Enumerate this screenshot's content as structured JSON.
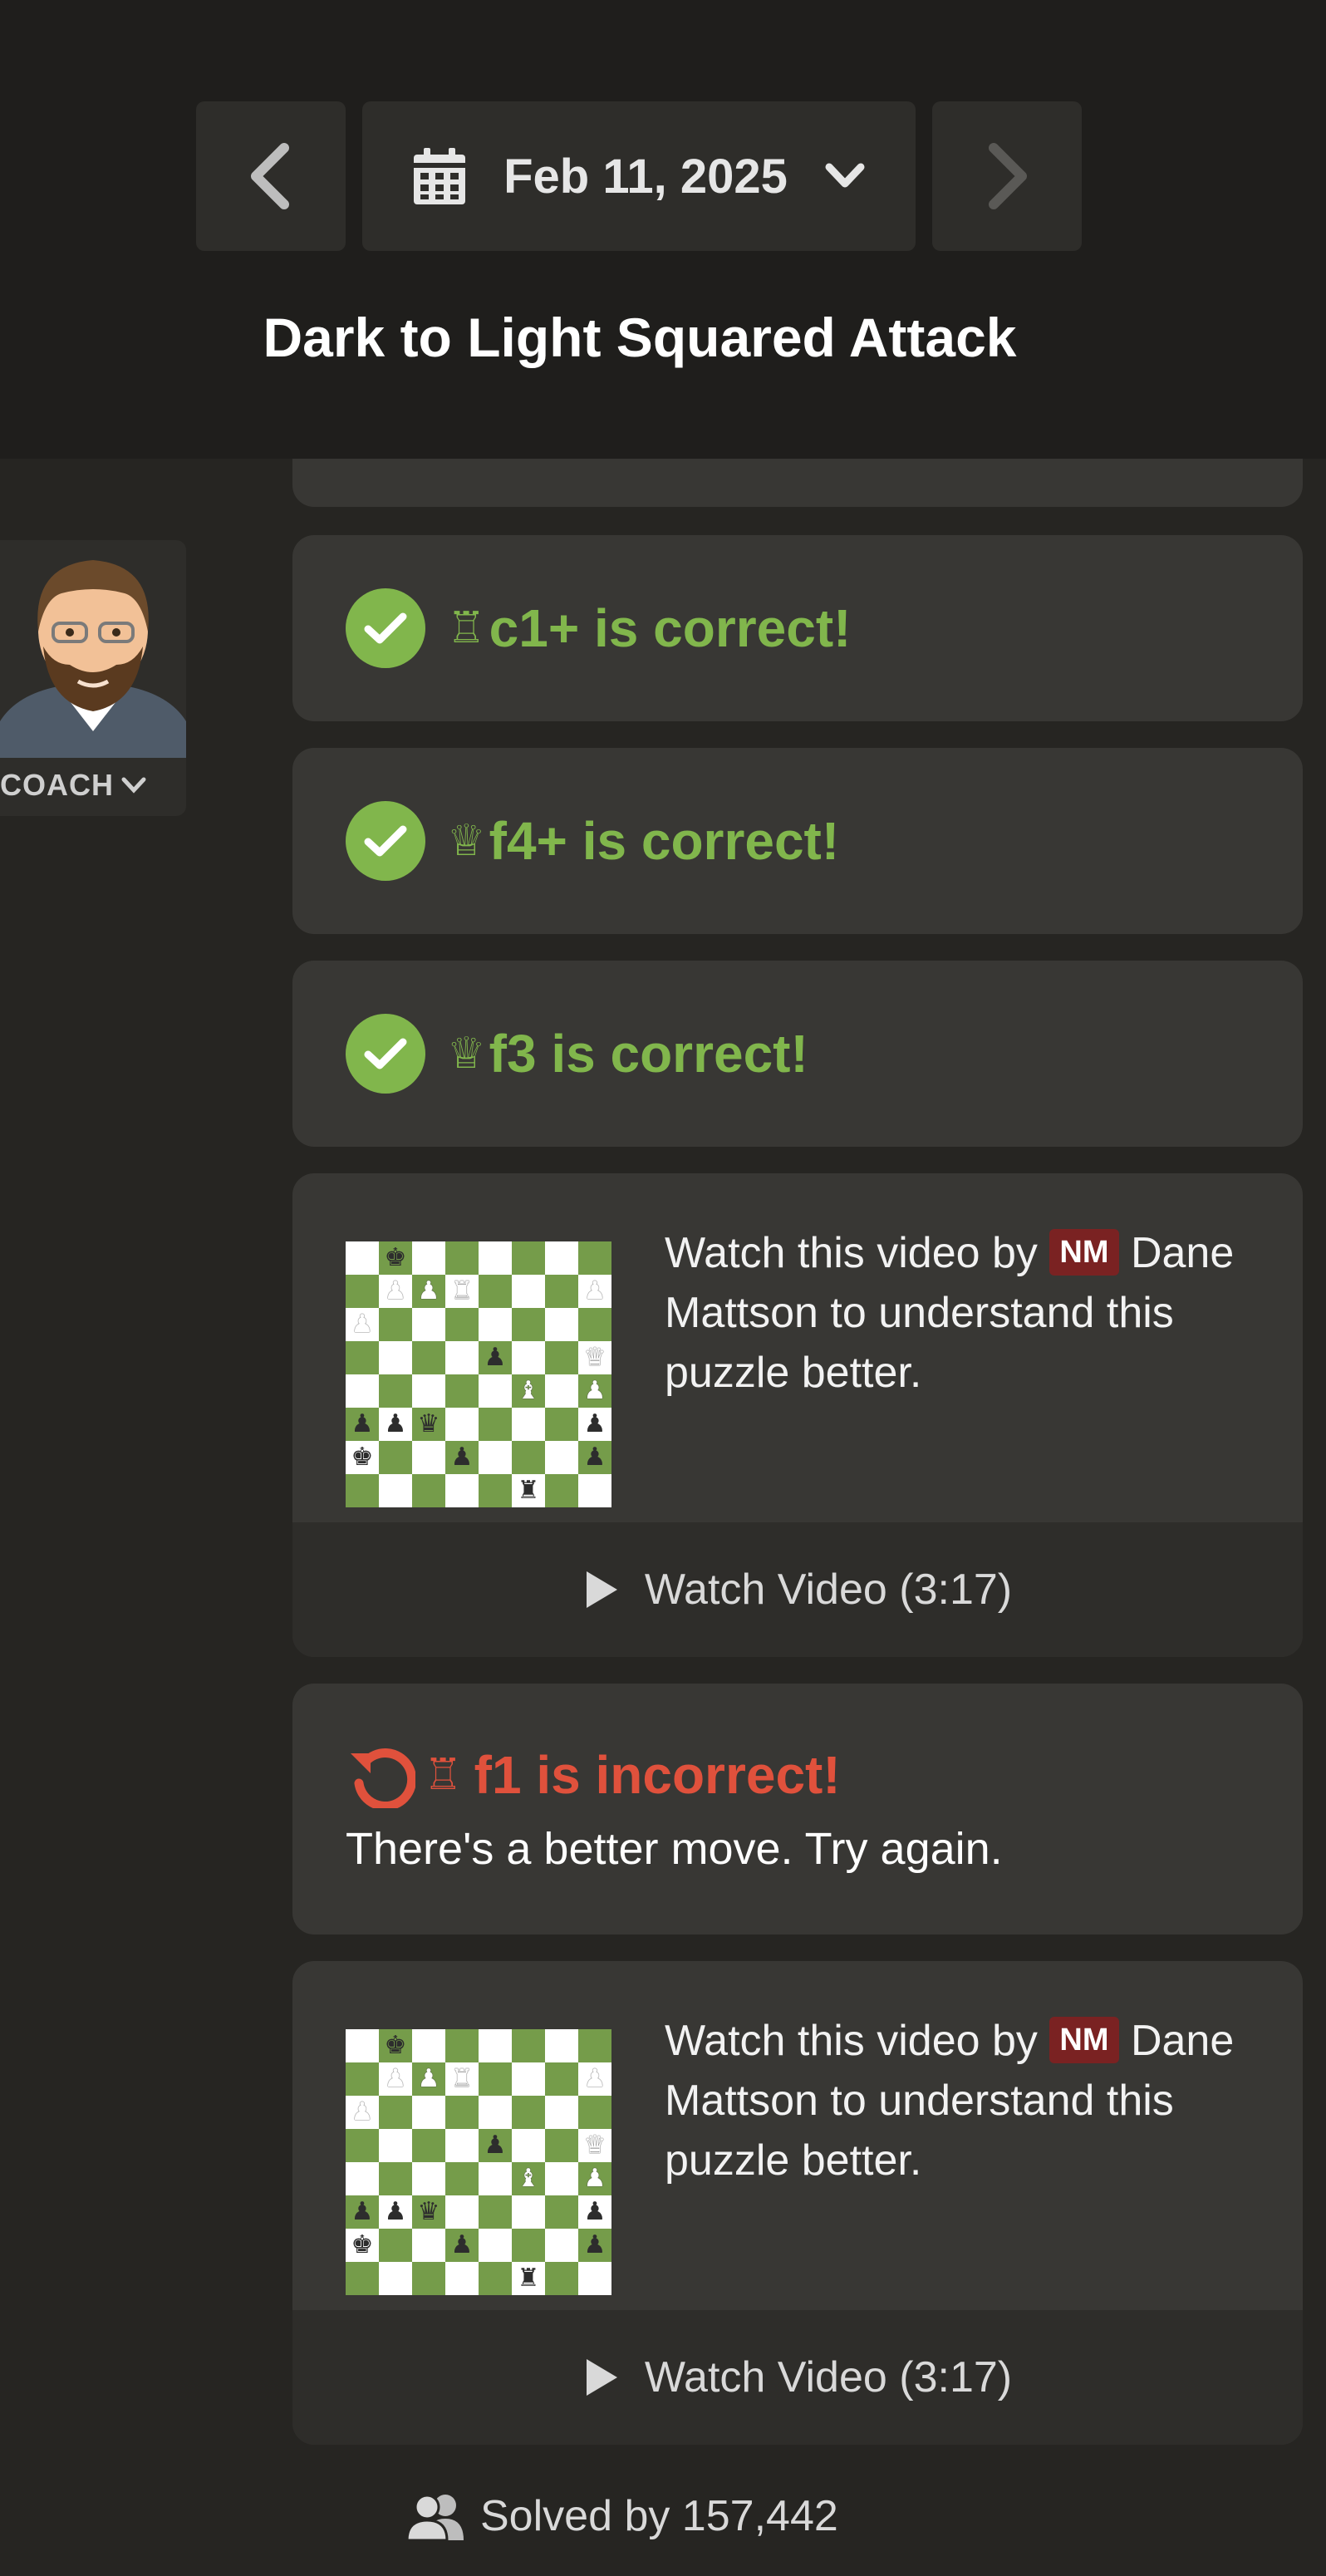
{
  "header": {
    "date": "Feb 11, 2025",
    "title": "Dark to Light Squared Attack",
    "icons": {
      "prev": "chevron-left-icon",
      "calendar": "calendar-icon",
      "dropdown": "chevron-down-icon",
      "next": "chevron-right-icon"
    }
  },
  "coach": {
    "label": "COACH"
  },
  "moves": [
    {
      "status": "correct",
      "piece": "♖",
      "text": "c1+ is correct!"
    },
    {
      "status": "correct",
      "piece": "♕",
      "text": "f4+ is correct!"
    },
    {
      "status": "correct",
      "piece": "♕",
      "text": "f3 is correct!"
    }
  ],
  "video": {
    "text_before": "Watch this video by",
    "title_badge": "NM",
    "text_after": "Dane Mattson to understand this puzzle better.",
    "button_label": "Watch Video (3:17)"
  },
  "incorrect": {
    "piece": "♖",
    "text": "f1 is incorrect!",
    "subtext": "There's a better move. Try again."
  },
  "footer": {
    "solved": "Solved by 157,442"
  },
  "colors": {
    "correct": "#81b64c",
    "incorrect": "#e0513c",
    "badge": "#7a2222",
    "board_dark": "#759c4a",
    "board_light": "#ffffff"
  }
}
